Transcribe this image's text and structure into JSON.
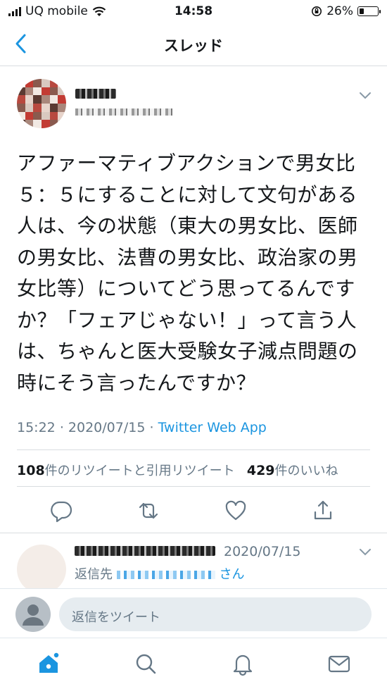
{
  "status_bar": {
    "carrier": "UQ mobile",
    "time": "14:58",
    "battery": "26%",
    "battery_level": 0.26
  },
  "nav": {
    "title": "スレッド",
    "back_icon": "chevron-left-icon"
  },
  "tweet": {
    "text": "アファーマティブアクションで男女比\n５：５にすることに対して文句がある\n人は、今の状態（東大の男女比、医師\nの男女比、法曹の男女比、政治家の男\n女比等）についてどう思ってるんです\nか？「フェアじゃない！」って言う人\nは、ちゃんと医大受験女子減点問題の\n時にそう言ったんですか？",
    "time": "15:22",
    "date": "2020/07/15",
    "separator": "·",
    "source": "Twitter Web App",
    "retweet_count": "108",
    "retweet_label": "件のリツイートと引用リツイート",
    "like_count": "429",
    "like_label": "件のいいね"
  },
  "actions": {
    "icons": [
      "reply-icon",
      "retweet-icon",
      "like-icon",
      "share-icon"
    ]
  },
  "reply": {
    "date": "2020/07/15",
    "reply_to_prefix": "返信先",
    "reply_to_suffix": "さん"
  },
  "compose": {
    "placeholder": "返信をツイート"
  },
  "tabbar": {
    "icons": [
      "home-icon",
      "search-icon",
      "notifications-icon",
      "messages-icon"
    ]
  },
  "colors": {
    "accent": "#1b95e0",
    "text": "#14171a",
    "secondary": "#657786",
    "divider": "#d9dde0"
  }
}
